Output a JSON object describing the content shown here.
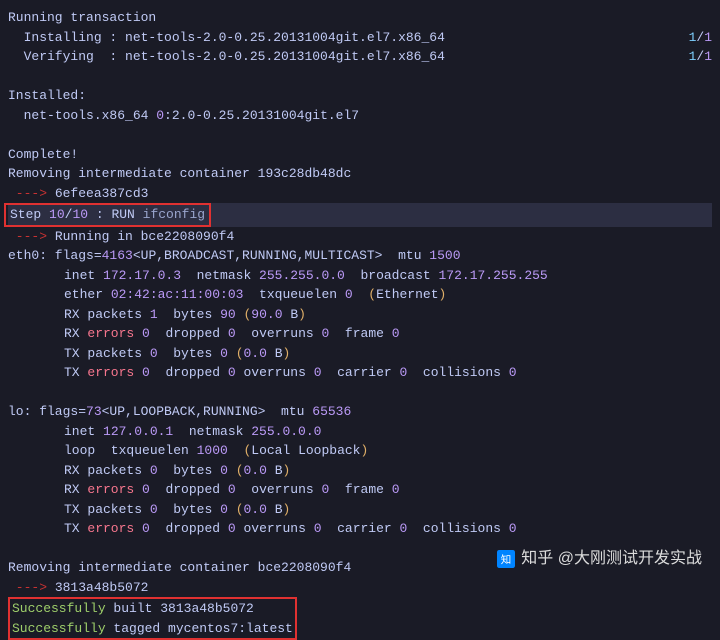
{
  "l1": "Running transaction",
  "l2a": "  Installing : net-tools-2.0-0.25.20131004git.el7.x86_64",
  "l2b": "1",
  "l2c": "/",
  "l2d": "1",
  "l3a": "  Verifying  : net-tools-2.0-0.25.20131004git.el7.x86_64",
  "l3b": "1",
  "l3c": "/",
  "l3d": "1",
  "l5": "Installed:",
  "l6a": "  net-tools.x86_64 ",
  "l6b": "0",
  "l6c": ":2.0-0.25.20131004git.el7",
  "l8": "Complete!",
  "l9": "Removing intermediate container 193c28db48dc",
  "l10a": " ---> ",
  "l10b": "6efeea387cd3",
  "l11a": "Step ",
  "l11b": "10",
  "l11c": "/",
  "l11d": "10",
  "l11e": " : RUN ",
  "l11f": "ifconfig",
  "l12a": " ---> ",
  "l12b": "Running in bce2208090f4",
  "l13a": "eth0: flags=",
  "l13b": "4163",
  "l13c": "<UP,BROADCAST,RUNNING,MULTICAST>  mtu ",
  "l13d": "1500",
  "l14a": "inet ",
  "l14b": "172.17.0.3",
  "l14c": "  netmask ",
  "l14d": "255.255.0.0",
  "l14e": "  broadcast ",
  "l14f": "172.17.255.255",
  "l15a": "ether ",
  "l15b": "02:42:ac:11:00:03",
  "l15c": "  txqueuelen ",
  "l15d": "0",
  "l15e": "  ",
  "l15f": "(",
  "l15g": "Ethernet",
  "l15h": ")",
  "l16a": "RX packets ",
  "l16b": "1",
  "l16c": "  bytes ",
  "l16d": "90",
  "l16e": " ",
  "l16f": "(",
  "l16g": "90.0",
  "l16h": " B",
  "l16i": ")",
  "l17a": "RX ",
  "l17b": "errors",
  "l17c": " ",
  "l17d": "0",
  "l17e": "  dropped ",
  "l17f": "0",
  "l17g": "  overruns ",
  "l17h": "0",
  "l17i": "  frame ",
  "l17j": "0",
  "l18a": "TX packets ",
  "l18b": "0",
  "l18c": "  bytes ",
  "l18d": "0",
  "l18e": " ",
  "l18f": "(",
  "l18g": "0.0",
  "l18h": " B",
  "l18i": ")",
  "l19a": "TX ",
  "l19b": "errors",
  "l19c": " ",
  "l19d": "0",
  "l19e": "  dropped ",
  "l19f": "0",
  "l19g": " overruns ",
  "l19h": "0",
  "l19i": "  carrier ",
  "l19j": "0",
  "l19k": "  collisions ",
  "l19l": "0",
  "l21a": "lo: flags=",
  "l21b": "73",
  "l21c": "<UP,LOOPBACK,RUNNING>  mtu ",
  "l21d": "65536",
  "l22a": "inet ",
  "l22b": "127.0.0.1",
  "l22c": "  netmask ",
  "l22d": "255.0.0.0",
  "l23a": "loop  txqueuelen ",
  "l23b": "1000",
  "l23c": "  ",
  "l23d": "(",
  "l23e": "Local Loopback",
  "l23f": ")",
  "l24a": "RX packets ",
  "l24b": "0",
  "l24c": "  bytes ",
  "l24d": "0",
  "l24e": " ",
  "l24f": "(",
  "l24g": "0.0",
  "l24h": " B",
  "l24i": ")",
  "l25a": "RX ",
  "l25b": "errors",
  "l25c": " ",
  "l25d": "0",
  "l25e": "  dropped ",
  "l25f": "0",
  "l25g": "  overruns ",
  "l25h": "0",
  "l25i": "  frame ",
  "l25j": "0",
  "l26a": "TX packets ",
  "l26b": "0",
  "l26c": "  bytes ",
  "l26d": "0",
  "l26e": " ",
  "l26f": "(",
  "l26g": "0.0",
  "l26h": " B",
  "l26i": ")",
  "l27a": "TX ",
  "l27b": "errors",
  "l27c": " ",
  "l27d": "0",
  "l27e": "  dropped ",
  "l27f": "0",
  "l27g": " overruns ",
  "l27h": "0",
  "l27i": "  carrier ",
  "l27j": "0",
  "l27k": "  collisions ",
  "l27l": "0",
  "l29": "Removing intermediate container bce2208090f4",
  "l30a": " ---> ",
  "l30b": "3813a48b5072",
  "l31a": "Successfully",
  "l31b": " built 3813a48b5072",
  "l32a": "Successfully",
  "l32b": " tagged mycentos7:latest",
  "watermark": "知乎 @大刚测试开发实战"
}
